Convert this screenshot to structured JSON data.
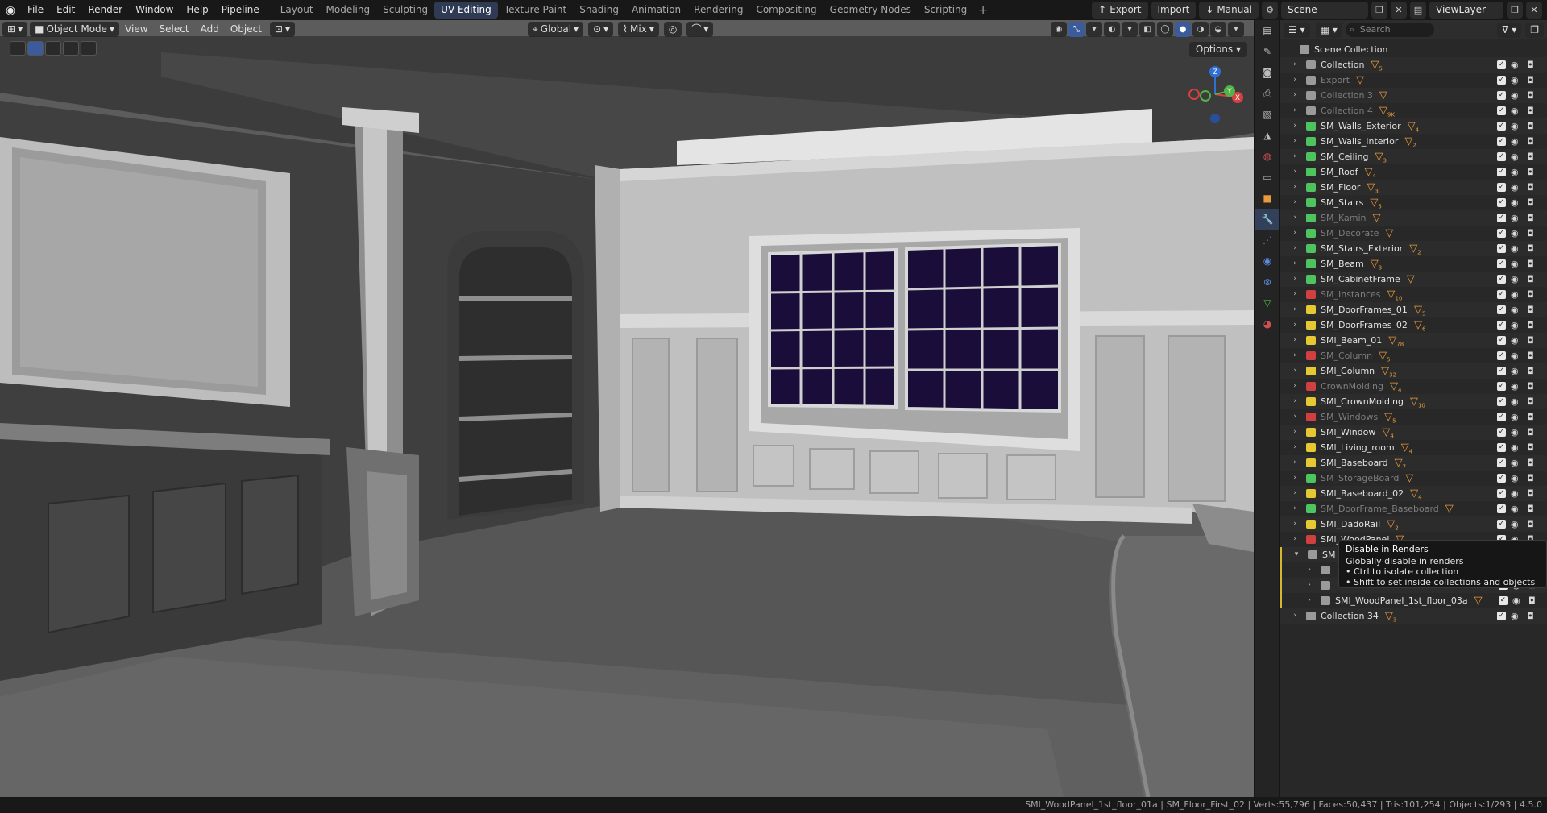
{
  "app": {
    "menus": [
      "File",
      "Edit",
      "Render",
      "Window",
      "Help",
      "Pipeline"
    ],
    "workspaces": [
      {
        "label": "Layout",
        "active": false
      },
      {
        "label": "Modeling",
        "active": false
      },
      {
        "label": "Sculpting",
        "active": false
      },
      {
        "label": "UV Editing",
        "active": true
      },
      {
        "label": "Texture Paint",
        "active": false
      },
      {
        "label": "Shading",
        "active": false
      },
      {
        "label": "Animation",
        "active": false
      },
      {
        "label": "Rendering",
        "active": false
      },
      {
        "label": "Compositing",
        "active": false
      },
      {
        "label": "Geometry Nodes",
        "active": false
      },
      {
        "label": "Scripting",
        "active": false
      }
    ],
    "top_right": {
      "export": "Export",
      "import": "Import",
      "manual": "Manual",
      "scene": "Scene",
      "view_layer": "ViewLayer"
    }
  },
  "viewport": {
    "mode": "Object Mode",
    "menus": [
      "View",
      "Select",
      "Add",
      "Object"
    ],
    "transform_orientation": "Global",
    "snap": "Mix",
    "options": "Options",
    "gizmo_labels": {
      "x": "X",
      "y": "Y",
      "z": "Z"
    }
  },
  "outliner": {
    "search_placeholder": "Search",
    "root": "Scene Collection",
    "rows": [
      {
        "name": "Collection",
        "color": "#9a9a9a",
        "dim": false,
        "count": "5"
      },
      {
        "name": "Export",
        "color": "#9a9a9a",
        "dim": true,
        "count": ""
      },
      {
        "name": "Collection 3",
        "color": "#9a9a9a",
        "dim": true,
        "count": ""
      },
      {
        "name": "Collection 4",
        "color": "#9a9a9a",
        "dim": true,
        "count": "9K"
      },
      {
        "name": "SM_Walls_Exterior",
        "color": "#4dc45e",
        "dim": false,
        "count": "4"
      },
      {
        "name": "SM_Walls_Interior",
        "color": "#4dc45e",
        "dim": false,
        "count": "2"
      },
      {
        "name": "SM_Ceiling",
        "color": "#4dc45e",
        "dim": false,
        "count": "3"
      },
      {
        "name": "SM_Roof",
        "color": "#4dc45e",
        "dim": false,
        "count": "4"
      },
      {
        "name": "SM_Floor",
        "color": "#4dc45e",
        "dim": false,
        "count": "3"
      },
      {
        "name": "SM_Stairs",
        "color": "#4dc45e",
        "dim": false,
        "count": "5"
      },
      {
        "name": "SM_Kamin",
        "color": "#4dc45e",
        "dim": true,
        "count": ""
      },
      {
        "name": "SM_Decorate",
        "color": "#4dc45e",
        "dim": true,
        "count": ""
      },
      {
        "name": "SM_Stairs_Exterior",
        "color": "#4dc45e",
        "dim": false,
        "count": "2"
      },
      {
        "name": "SM_Beam",
        "color": "#4dc45e",
        "dim": false,
        "count": "3"
      },
      {
        "name": "SM_CabinetFrame",
        "color": "#4dc45e",
        "dim": false,
        "count": ""
      },
      {
        "name": "SM_Instances",
        "color": "#d04040",
        "dim": true,
        "count": "10"
      },
      {
        "name": "SM_DoorFrames_01",
        "color": "#e6c833",
        "dim": false,
        "count": "5"
      },
      {
        "name": "SM_DoorFrames_02",
        "color": "#e6c833",
        "dim": false,
        "count": "6"
      },
      {
        "name": "SMl_Beam_01",
        "color": "#e6c833",
        "dim": false,
        "count": "78"
      },
      {
        "name": "SM_Column",
        "color": "#d04040",
        "dim": true,
        "count": "5"
      },
      {
        "name": "SMl_Column",
        "color": "#e6c833",
        "dim": false,
        "count": "32"
      },
      {
        "name": "CrownMolding",
        "color": "#d04040",
        "dim": true,
        "count": "4"
      },
      {
        "name": "SMl_CrownMolding",
        "color": "#e6c833",
        "dim": false,
        "count": "10"
      },
      {
        "name": "SM_Windows",
        "color": "#d04040",
        "dim": true,
        "count": "5"
      },
      {
        "name": "SMl_Window",
        "color": "#e6c833",
        "dim": false,
        "count": "4"
      },
      {
        "name": "SMl_Living_room",
        "color": "#e6c833",
        "dim": false,
        "count": "4"
      },
      {
        "name": "SMl_Baseboard",
        "color": "#e6c833",
        "dim": false,
        "count": "7"
      },
      {
        "name": "SM_StorageBoard",
        "color": "#4dc45e",
        "dim": true,
        "count": ""
      },
      {
        "name": "SMl_Baseboard_02",
        "color": "#e6c833",
        "dim": false,
        "count": "4"
      },
      {
        "name": "SM_DoorFrame_Baseboard",
        "color": "#4dc45e",
        "dim": true,
        "count": ""
      },
      {
        "name": "SMl_DadoRail",
        "color": "#e6c833",
        "dim": false,
        "count": "2"
      },
      {
        "name": "SMl_WoodPanel",
        "color": "#d04040",
        "dim": false,
        "count": ""
      },
      {
        "name": "SM",
        "color": "#9a9a9a",
        "dim": false,
        "count": ""
      },
      {
        "name": "",
        "color": "#9a9a9a",
        "dim": false,
        "count": ""
      },
      {
        "name": "",
        "color": "#9a9a9a",
        "dim": false,
        "count": ""
      },
      {
        "name": "SMl_WoodPanel_1st_floor_03a",
        "color": "#9a9a9a",
        "dim": false,
        "count": ""
      },
      {
        "name": "Collection 34",
        "color": "#9a9a9a",
        "dim": false,
        "count": "3"
      }
    ],
    "tooltip": {
      "title": "Disable in Renders",
      "line1": "Globally disable in renders",
      "line2": "• Ctrl to isolate collection",
      "line3": "• Shift to set inside collections and objects"
    }
  },
  "statusbar": {
    "text": "SMl_WoodPanel_1st_floor_01a | SM_Floor_First_02 | Verts:55,796 | Faces:50,437 | Tris:101,254 | Objects:1/293 | 4.5.0"
  }
}
